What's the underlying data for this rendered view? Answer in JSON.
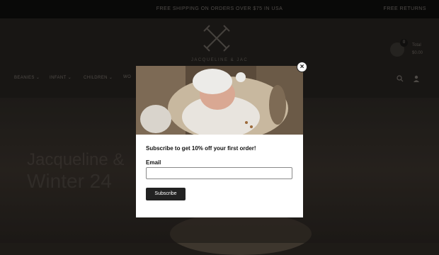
{
  "announcement": {
    "center_text": "FREE SHIPPING ON ORDERS OVER $75 IN USA",
    "right_text": "FREE RETURNS"
  },
  "header": {
    "logo_text": "JACQUELINE & JAC",
    "cart": {
      "count": "0",
      "label": "Total",
      "total": "$0.00"
    }
  },
  "nav": {
    "items": [
      {
        "label": "BEANIES"
      },
      {
        "label": "INFANT"
      },
      {
        "label": "CHILDREN"
      },
      {
        "label": "WO"
      }
    ]
  },
  "hero": {
    "line1": "Jacqueline &",
    "line2": "Winter 24"
  },
  "popup": {
    "heading": "Subscribe to get 10% off your first order!",
    "email_label": "Email",
    "email_value": "",
    "email_placeholder": "",
    "submit_label": "Subscribe",
    "close_symbol": "×"
  },
  "colors": {
    "overlay": "rgba(0,0,0,0.6)",
    "button": "#222222",
    "modal_bg": "#ffffff"
  }
}
